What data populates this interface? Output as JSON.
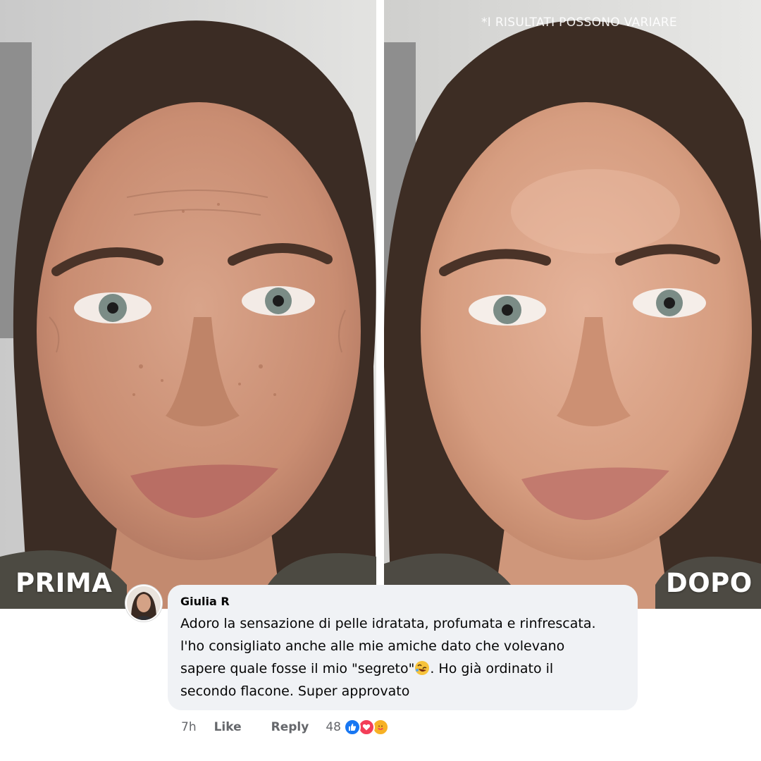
{
  "disclaimer": "*I RISULTATI POSSONO VARIARE",
  "labels": {
    "before": "PRIMA",
    "after": "DOPO"
  },
  "comment": {
    "author": "Giulia R",
    "lines": [
      "Adoro la sensazione di pelle idratata, profumata e rinfrescata.",
      "l'ho consigliato anche alle mie amiche dato che volevano",
      "sapere quale fosse il mio \"segreto\"",
      ". Ho già ordinato il",
      "secondo flacone. Super approvato"
    ],
    "emoji_icon": "rolling-on-floor-laughing-emoji",
    "time": "7h",
    "like_label": "Like",
    "reply_label": "Reply",
    "reaction_count": "48",
    "reaction_icons": [
      "like-reaction-icon",
      "love-reaction-icon",
      "care-reaction-icon"
    ]
  },
  "colors": {
    "bubble": "#f0f2f5",
    "meta_text": "#65676b",
    "like_blue": "#1877f2",
    "love_red": "#f33e58",
    "care_yellow": "#f7b125"
  }
}
